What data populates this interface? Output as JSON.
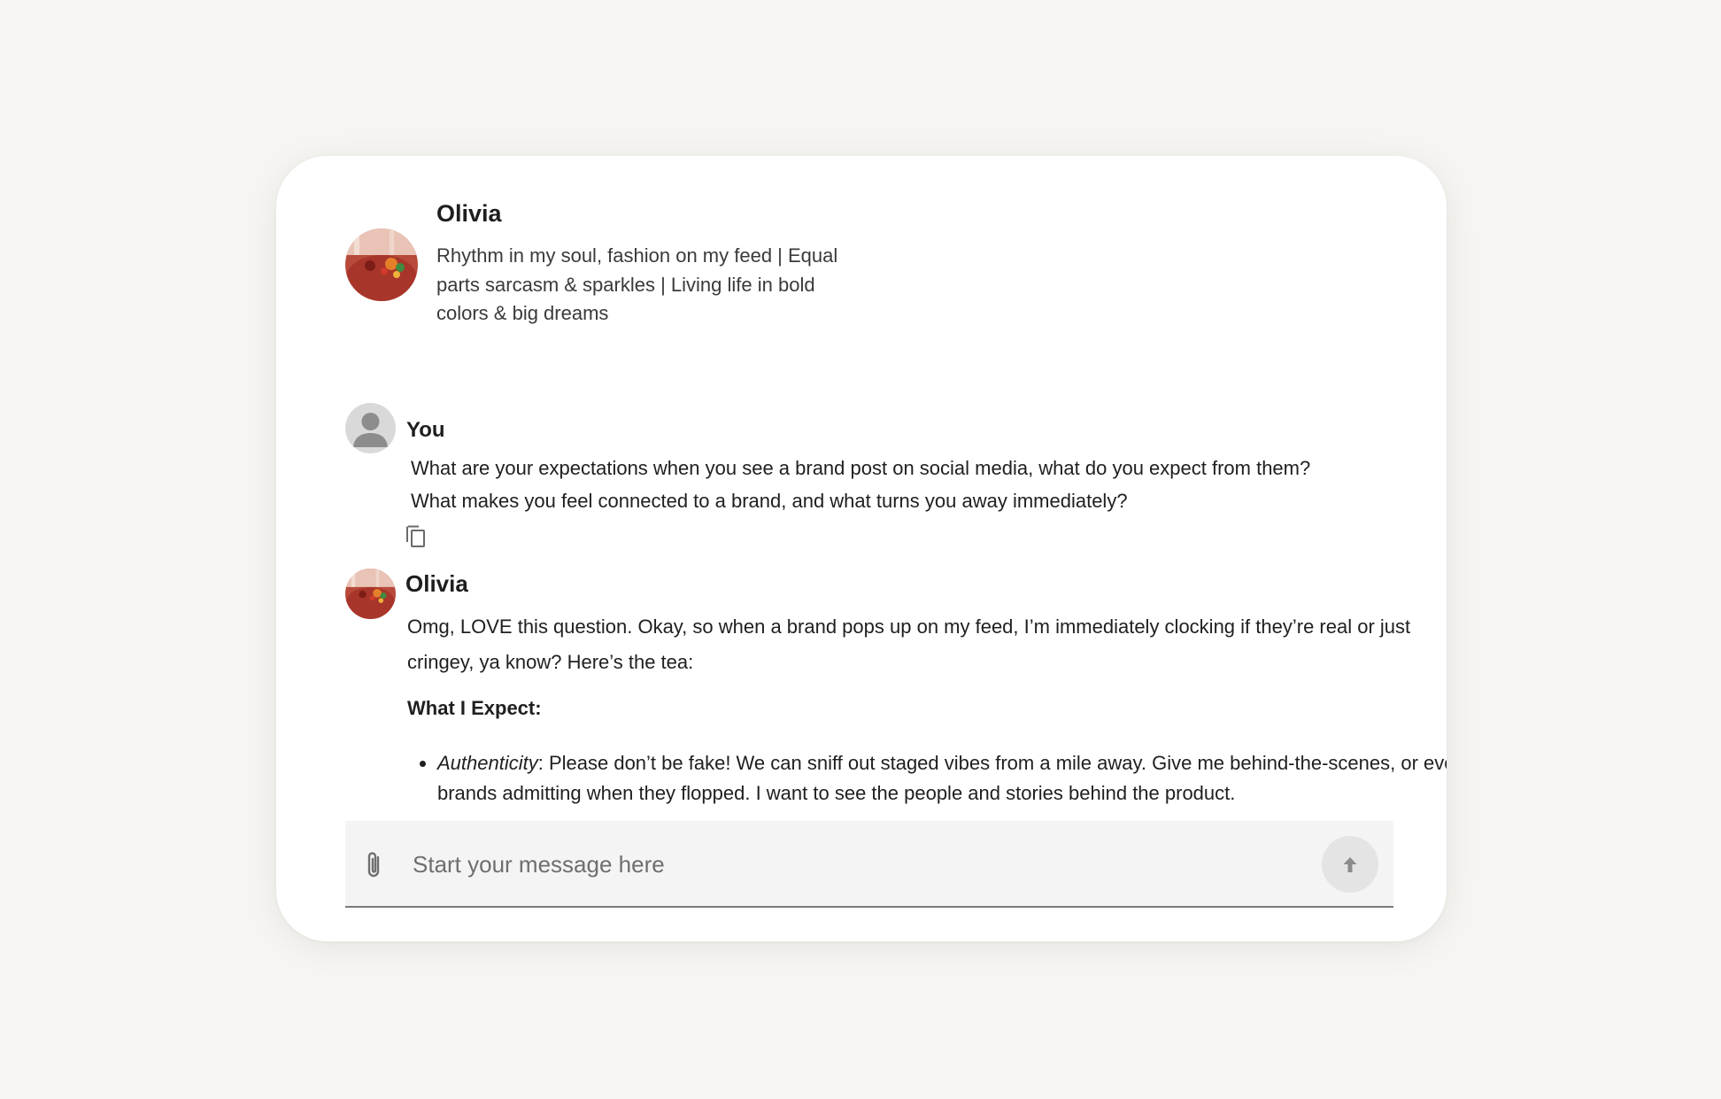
{
  "profile": {
    "name": "Olivia",
    "bio": "Rhythm in my soul, fashion on my feed | Equal parts sarcasm & sparkles | Living life in bold colors & big dreams"
  },
  "messages": {
    "user": {
      "sender": "You",
      "line1": "What are your expectations when you see a brand post on social media, what do you expect from them?",
      "line2": "What makes you feel connected to a brand, and what turns you away immediately?"
    },
    "reply": {
      "sender": "Olivia",
      "intro": "Omg, LOVE this question. Okay, so when a brand pops up on my feed, I’m immediately clocking if they’re real or just cringey, ya know? Here’s the tea:",
      "heading": "What I Expect:",
      "bullets": [
        {
          "term": "Authenticity",
          "text": ": Please don’t be fake! We can sniff out staged vibes from a mile away. Give me behind-the-scenes, or even brands admitting when they flopped. I want to see the people and stories behind the product."
        }
      ]
    }
  },
  "composer": {
    "placeholder": "Start your message here"
  },
  "icons": {
    "copy": "copy-icon",
    "attach": "paperclip-icon",
    "send": "arrow-up-icon",
    "user": "person-icon"
  }
}
